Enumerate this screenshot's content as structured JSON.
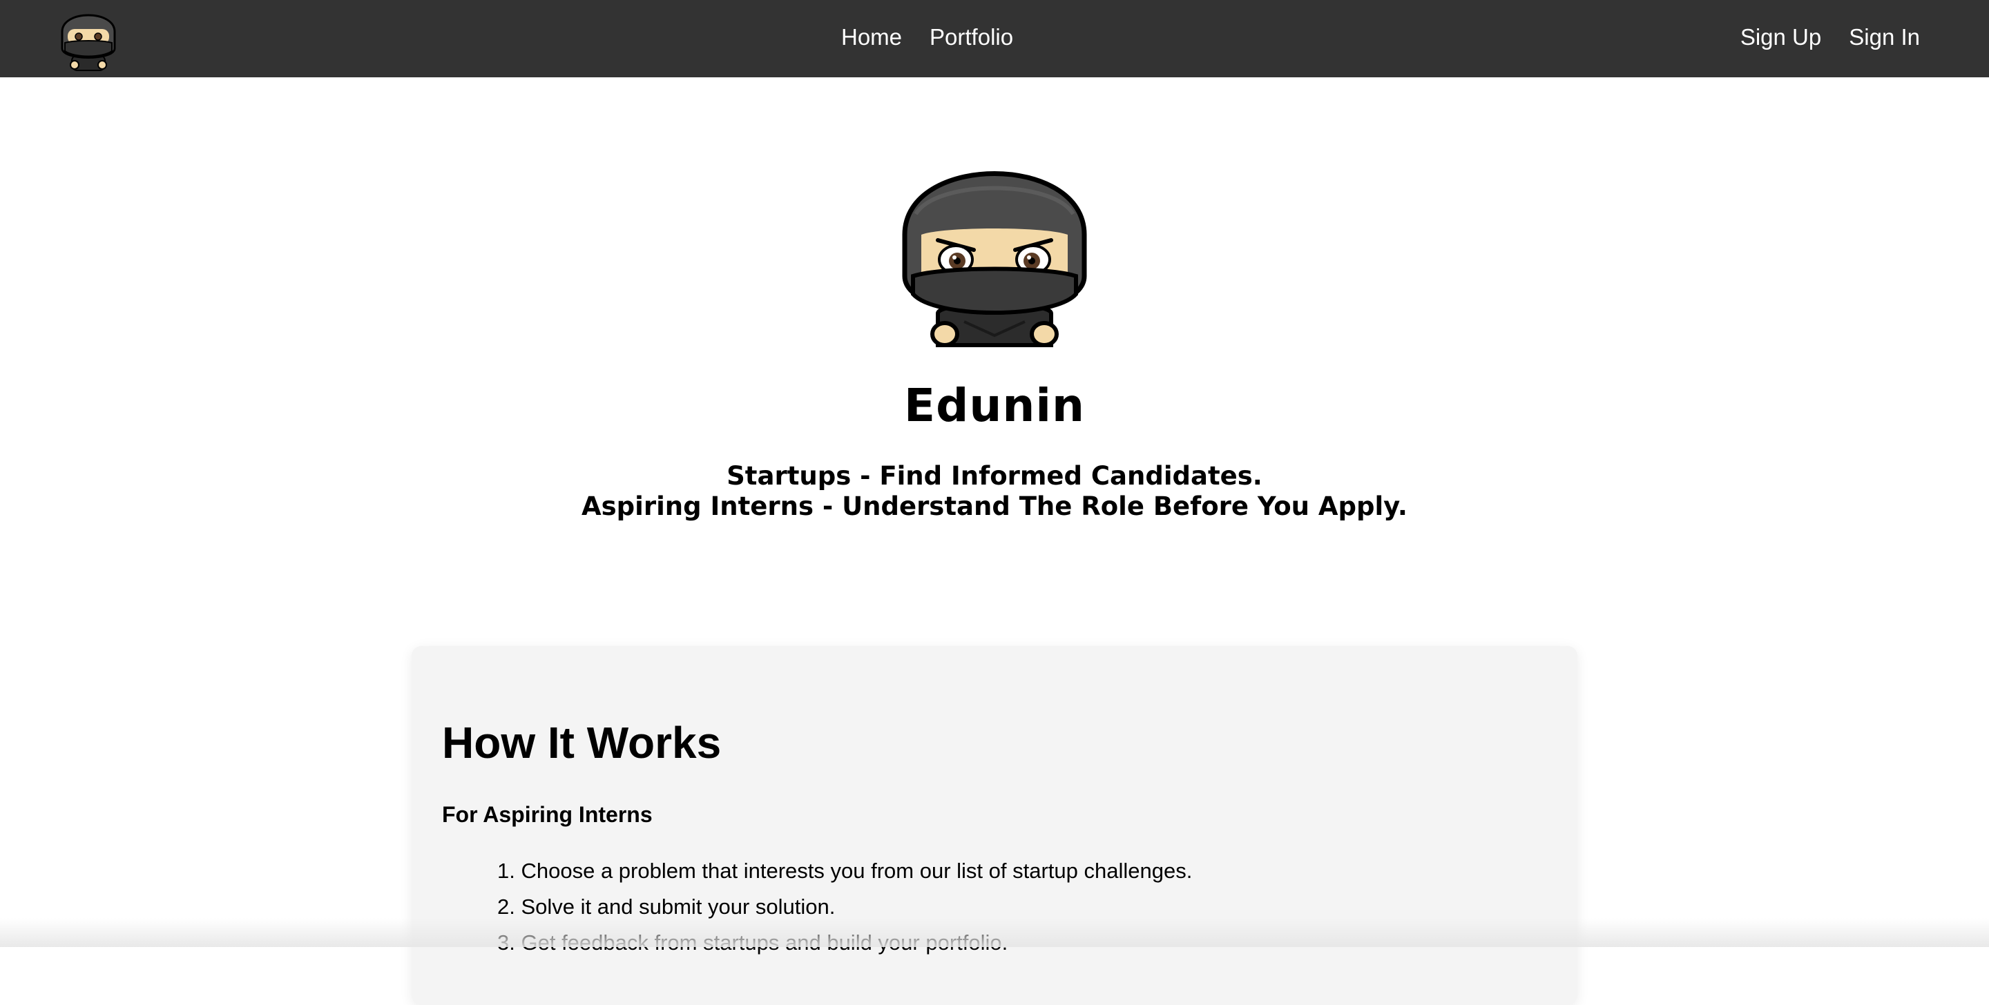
{
  "nav": {
    "center_links": [
      {
        "label": "Home"
      },
      {
        "label": "Portfolio"
      }
    ],
    "right_links": [
      {
        "label": "Sign Up"
      },
      {
        "label": "Sign In"
      }
    ]
  },
  "hero": {
    "title": "Edunin",
    "subtitle_line1": "Startups - Find Informed Candidates.",
    "subtitle_line2": "Aspiring Interns - Understand The Role Before You Apply."
  },
  "how_it_works": {
    "heading": "How It Works",
    "subheading": "For Aspiring Interns",
    "steps": [
      {
        "number": "1.",
        "text": "Choose a problem that interests you from our list of startup challenges."
      },
      {
        "number": "2.",
        "text": "Solve it and submit your solution."
      },
      {
        "number": "3.",
        "text": "Get feedback from startups and build your portfolio."
      }
    ]
  },
  "icons": {
    "logo": "ninja-logo-icon"
  },
  "colors": {
    "navbar_bg": "#333333",
    "card_bg": "#f4f4f4",
    "ninja_hood": "#4a4a4a",
    "ninja_skin": "#f3d9a8"
  }
}
